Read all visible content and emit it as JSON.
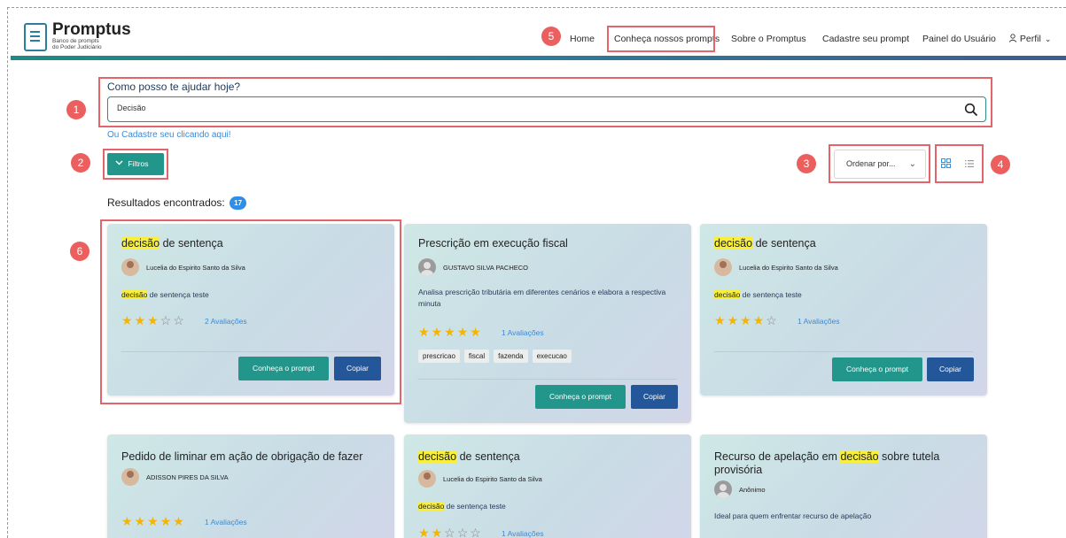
{
  "header": {
    "logo_title": "Promptus",
    "logo_subtitle": "Banco de prompts do Poder Judiciário",
    "nav": [
      {
        "label": "Home"
      },
      {
        "label": "Conheça nossos prompts"
      },
      {
        "label": "Sobre o Promptus"
      },
      {
        "label": "Cadastre seu prompt"
      },
      {
        "label": "Painel do Usuário"
      },
      {
        "label": "Perfil"
      }
    ]
  },
  "search": {
    "label": "Como posso te ajudar hoje?",
    "value": "Decisão",
    "register_link": "Ou Cadastre seu clicando aqui!"
  },
  "filters_label": "Filtros",
  "sort": {
    "selected": "Ordenar por..."
  },
  "results": {
    "label": "Resultados encontrados:",
    "count": "17"
  },
  "annotations": [
    "1",
    "2",
    "3",
    "4",
    "5",
    "6"
  ],
  "colors": {
    "accent": "#23968b",
    "primary": "#24569a",
    "highlight": "#f7ef3a",
    "annotation": "#ec5f5f"
  },
  "cards": [
    {
      "title_pre": "",
      "title_hl": "decisão",
      "title_post": " de sentença",
      "author": "Lucelia do Espirito Santo da Silva",
      "desc_hl": "decisão",
      "desc_post": " de sentença teste",
      "rating": 3,
      "rating_label": "2 Avaliações",
      "view_label": "Conheça o prompt",
      "copy_label": "Copiar"
    },
    {
      "title_pre": "Prescrição em execução fiscal",
      "author": "GUSTAVO SILVA PACHECO",
      "desc": "Analisa prescrição tributária em diferentes cenários e elabora a respectiva minuta",
      "rating": 5,
      "rating_label": "1 Avaliações",
      "tags": [
        "prescricao",
        "fiscal",
        "fazenda",
        "execucao"
      ],
      "view_label": "Conheça o prompt",
      "copy_label": "Copiar"
    },
    {
      "title_pre": "",
      "title_hl": "decisão",
      "title_post": " de sentença",
      "author": "Lucelia do Espirito Santo da Silva",
      "desc_hl": "decisão",
      "desc_post": " de sentença teste",
      "rating": 4,
      "rating_label": "1 Avaliações",
      "view_label": "Conheça o prompt",
      "copy_label": "Copiar"
    },
    {
      "title_pre": "Pedido de liminar em ação de obrigação de fazer",
      "author": "ADISSON PIRES DA SILVA",
      "rating": 5,
      "rating_label": "1 Avaliações"
    },
    {
      "title_pre": "",
      "title_hl": "decisão",
      "title_post": " de sentença",
      "author": "Lucelia do Espirito Santo da Silva",
      "desc_hl": "decisão",
      "desc_post": " de sentença teste",
      "rating": 2,
      "rating_label": "1 Avaliações"
    },
    {
      "title_pre": "Recurso de apelação em ",
      "title_hl": "decisão",
      "title_post": " sobre tutela provisória",
      "author": "Anônimo",
      "desc": "Ideal para quem enfrentar recurso de apelação"
    }
  ]
}
